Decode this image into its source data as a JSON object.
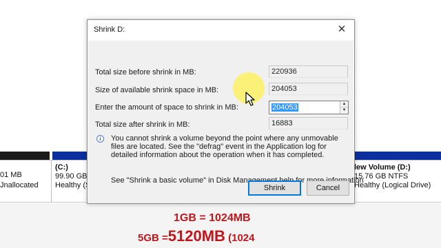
{
  "dialog": {
    "title": "Shrink D:",
    "total_before_label": "Total size before shrink in MB:",
    "total_before_value": "220936",
    "available_label": "Size of available shrink space in MB:",
    "available_value": "204053",
    "amount_label": "Enter the amount of space to shrink in MB:",
    "amount_value": "204053",
    "total_after_label": "Total size after shrink in MB:",
    "total_after_value": "16883",
    "info_text": "You cannot shrink a volume beyond the point where any unmovable files are located. See the \"defrag\" event in the Application log for detailed information about the operation when it has completed.",
    "help_text": "See \"Shrink a basic volume\" in Disk Management help for more information",
    "shrink_button": "Shrink",
    "cancel_button": "Cancel",
    "close_glyph": "✕",
    "info_glyph": "i",
    "spin_up_glyph": "▲",
    "spin_down_glyph": "▼"
  },
  "disk_map": {
    "unallocated_size": "01 MB",
    "unallocated_label": "Jnallocated",
    "c_drive_name": "(C:)",
    "c_drive_size": "99.90 GB N",
    "c_drive_status": "Healthy (S",
    "new_volume_name": "lew Volume  (D:)",
    "new_volume_size": "15.76 GB NTFS",
    "new_volume_status": "Healthy (Logical Drive)"
  },
  "captions": {
    "line1": "1GB = 1024MB",
    "line2_prefix": "5GB =",
    "line2_big": "5120MB",
    "line2_suffix": " (1024"
  },
  "colors": {
    "caption_red": "#c0161b",
    "partition_blue": "#0c2f9e",
    "selection_blue": "#3399ff"
  },
  "icons": [
    "close-icon",
    "info-icon",
    "mouse-cursor-icon"
  ]
}
